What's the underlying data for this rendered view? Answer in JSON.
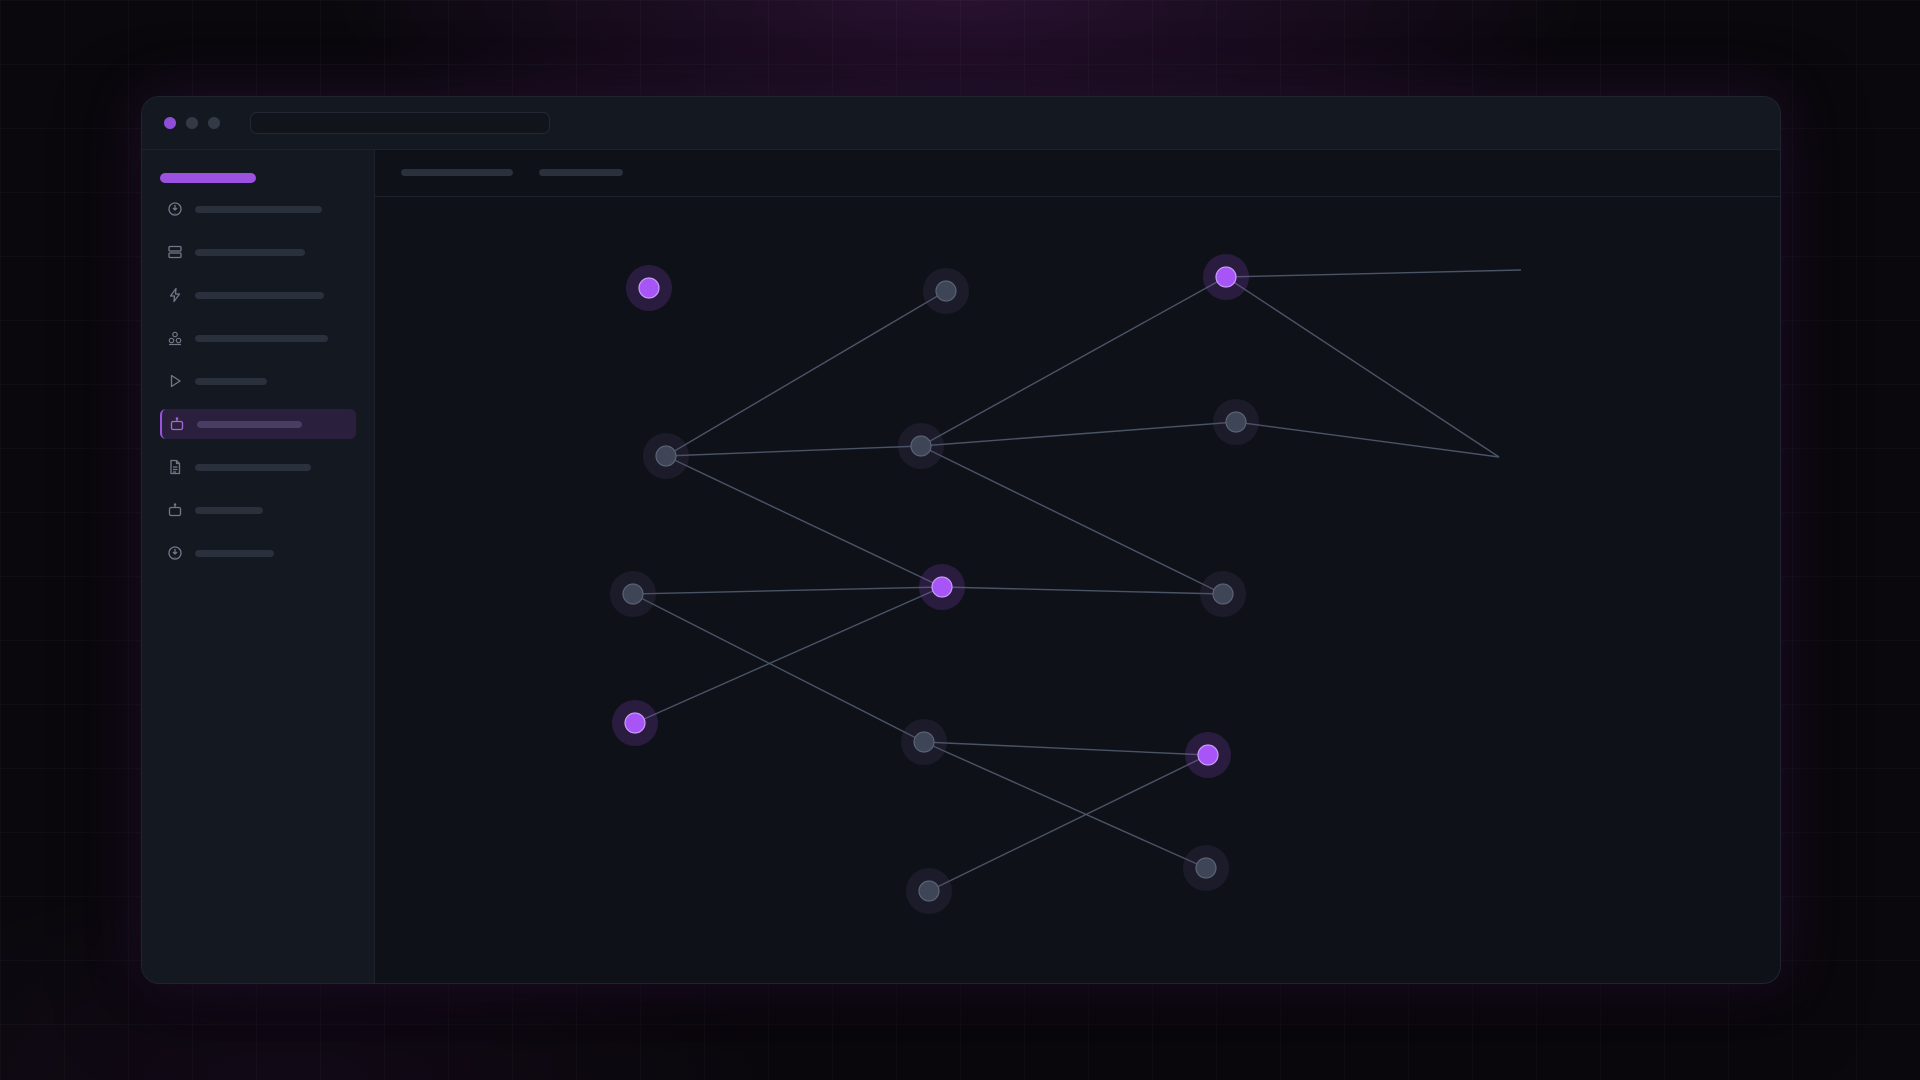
{
  "window": {
    "title_dots": [
      "close",
      "minimize",
      "maximize"
    ],
    "url_text": ""
  },
  "colors": {
    "accent": "#9b52e0",
    "accent_node": "#a855f7",
    "gray_node": "#3d4556",
    "edge": "#4a5466",
    "background": "#0e1118"
  },
  "sidebar": {
    "brand_label": "",
    "items": [
      {
        "icon": "globe-icon",
        "label": "",
        "active": false
      },
      {
        "icon": "server-icon",
        "label": "",
        "active": false
      },
      {
        "icon": "lightning-icon",
        "label": "",
        "active": false
      },
      {
        "icon": "cluster-icon",
        "label": "",
        "active": false
      },
      {
        "icon": "play-icon",
        "label": "",
        "active": false
      },
      {
        "icon": "robot-icon",
        "label": "",
        "active": true
      },
      {
        "icon": "document-icon",
        "label": "",
        "active": false
      },
      {
        "icon": "robot-icon",
        "label": "",
        "active": false
      },
      {
        "icon": "globe-icon",
        "label": "",
        "active": false
      }
    ]
  },
  "topbar": {
    "tabs": [
      {
        "label": ""
      },
      {
        "label": ""
      }
    ]
  },
  "graph": {
    "nodes": [
      {
        "id": "n1",
        "kind": "accent"
      },
      {
        "id": "n2",
        "kind": "gray"
      },
      {
        "id": "n3",
        "kind": "accent"
      },
      {
        "id": "n4",
        "kind": "gray"
      },
      {
        "id": "n5",
        "kind": "gray"
      },
      {
        "id": "n6",
        "kind": "gray"
      },
      {
        "id": "n7",
        "kind": "gray"
      },
      {
        "id": "n8",
        "kind": "accent"
      },
      {
        "id": "n9",
        "kind": "gray"
      },
      {
        "id": "n10",
        "kind": "accent"
      },
      {
        "id": "n11",
        "kind": "gray"
      },
      {
        "id": "n12",
        "kind": "accent"
      },
      {
        "id": "n13",
        "kind": "gray"
      },
      {
        "id": "n14",
        "kind": "gray"
      },
      {
        "id": "t1",
        "kind": "endpoint"
      },
      {
        "id": "t2",
        "kind": "endpoint"
      }
    ],
    "edges": [
      [
        "n5",
        "n2"
      ],
      [
        "n5",
        "n6"
      ],
      [
        "n5",
        "n8"
      ],
      [
        "n6",
        "n3"
      ],
      [
        "n6",
        "n4"
      ],
      [
        "n6",
        "n9"
      ],
      [
        "n7",
        "n8"
      ],
      [
        "n8",
        "n9"
      ],
      [
        "n7",
        "n11"
      ],
      [
        "n10",
        "n8"
      ],
      [
        "n11",
        "n12"
      ],
      [
        "n11",
        "n14"
      ],
      [
        "n13",
        "n12"
      ],
      [
        "n3",
        "t1"
      ],
      [
        "n3",
        "t2"
      ],
      [
        "n4",
        "t2"
      ]
    ]
  }
}
